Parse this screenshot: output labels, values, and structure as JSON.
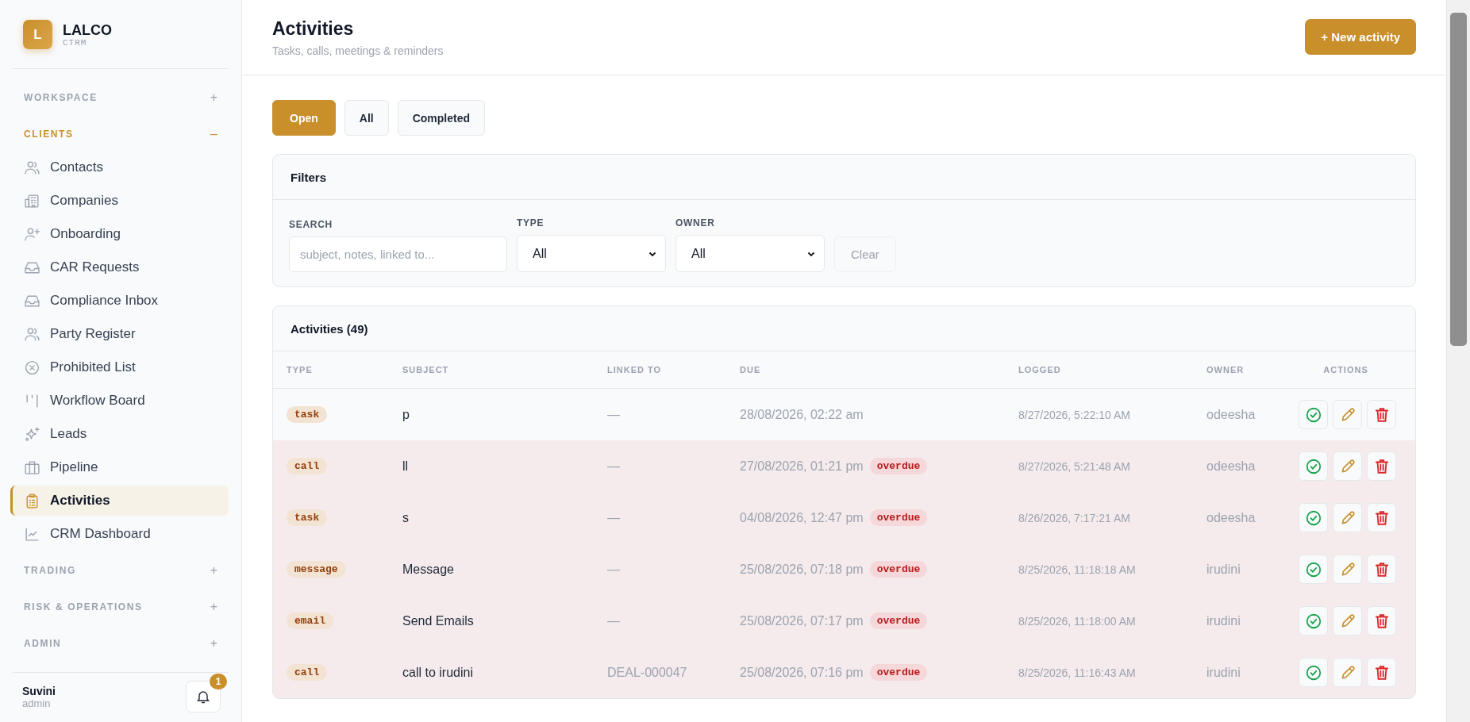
{
  "brand": {
    "logo_letter": "L",
    "name": "LALCO",
    "subtitle": "CTRM"
  },
  "sidebar": {
    "groups": [
      {
        "label": "WORKSPACE",
        "expanded": false,
        "toggle": "+"
      },
      {
        "label": "CLIENTS",
        "expanded": true,
        "toggle": "–",
        "items": [
          {
            "label": "Contacts",
            "selected": false
          },
          {
            "label": "Companies",
            "selected": false
          },
          {
            "label": "Onboarding",
            "selected": false
          },
          {
            "label": "CAR Requests",
            "selected": false
          },
          {
            "label": "Compliance Inbox",
            "selected": false
          },
          {
            "label": "Party Register",
            "selected": false
          },
          {
            "label": "Prohibited List",
            "selected": false
          },
          {
            "label": "Workflow Board",
            "selected": false
          },
          {
            "label": "Leads",
            "selected": false
          },
          {
            "label": "Pipeline",
            "selected": false
          },
          {
            "label": "Activities",
            "selected": true
          },
          {
            "label": "CRM Dashboard",
            "selected": false
          }
        ]
      },
      {
        "label": "TRADING",
        "expanded": false,
        "toggle": "+"
      },
      {
        "label": "RISK & OPERATIONS",
        "expanded": false,
        "toggle": "+"
      },
      {
        "label": "ADMIN",
        "expanded": false,
        "toggle": "+"
      }
    ],
    "user": {
      "name": "Suvini",
      "role": "admin",
      "notification_count": "1"
    }
  },
  "header": {
    "title": "Activities",
    "subtitle": "Tasks, calls, meetings & reminders",
    "new_button": "+ New activity"
  },
  "status_tabs": [
    {
      "label": "Open",
      "selected": true
    },
    {
      "label": "All",
      "selected": false
    },
    {
      "label": "Completed",
      "selected": false
    }
  ],
  "filters": {
    "title": "Filters",
    "search": {
      "label": "SEARCH",
      "placeholder": "subject, notes, linked to..."
    },
    "type": {
      "label": "TYPE",
      "value": "All"
    },
    "owner": {
      "label": "OWNER",
      "value": "All"
    },
    "clear_button": "Clear"
  },
  "table": {
    "title": "Activities (49)",
    "columns": [
      "TYPE",
      "SUBJECT",
      "LINKED TO",
      "DUE",
      "LOGGED",
      "OWNER",
      "ACTIONS"
    ],
    "rows": [
      {
        "type": "task",
        "subject": "p",
        "linked_to": "—",
        "due": "28/08/2026, 02:22 am",
        "overdue": false,
        "logged": "8/27/2026, 5:22:10 AM",
        "owner": "odeesha"
      },
      {
        "type": "call",
        "subject": "ll",
        "linked_to": "—",
        "due": "27/08/2026, 01:21 pm",
        "overdue": true,
        "overdue_tag": "overdue",
        "logged": "8/27/2026, 5:21:48 AM",
        "owner": "odeesha"
      },
      {
        "type": "task",
        "subject": "s",
        "linked_to": "—",
        "due": "04/08/2026, 12:47 pm",
        "overdue": true,
        "overdue_tag": "overdue",
        "logged": "8/26/2026, 7:17:21 AM",
        "owner": "odeesha"
      },
      {
        "type": "message",
        "subject": "Message",
        "linked_to": "—",
        "due": "25/08/2026, 07:18 pm",
        "overdue": true,
        "overdue_tag": "overdue",
        "logged": "8/25/2026, 11:18:18 AM",
        "owner": "irudini"
      },
      {
        "type": "email",
        "subject": "Send Emails",
        "linked_to": "—",
        "due": "25/08/2026, 07:17 pm",
        "overdue": true,
        "overdue_tag": "overdue",
        "logged": "8/25/2026, 11:18:00 AM",
        "owner": "irudini"
      },
      {
        "type": "call",
        "subject": "call to irudini",
        "linked_to": "DEAL-000047",
        "due": "25/08/2026, 07:16 pm",
        "overdue": true,
        "overdue_tag": "overdue",
        "logged": "8/25/2026, 11:16:43 AM",
        "owner": "irudini"
      }
    ]
  }
}
